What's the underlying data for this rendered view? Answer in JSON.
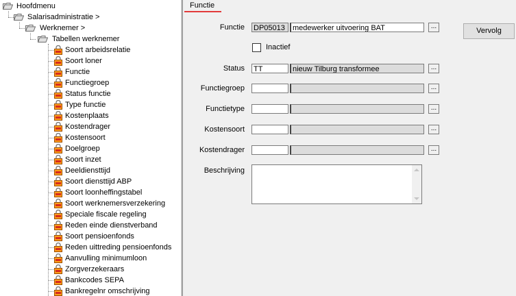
{
  "tree": {
    "root": "Hoofdmenu",
    "level1": "Salarisadministratie >",
    "level2": "Werknemer >",
    "level3": "Tabellen werknemer",
    "items": [
      "Soort arbeidsrelatie",
      "Soort loner",
      "Functie",
      "Functiegroep",
      "Status functie",
      "Type functie",
      "Kostenplaats",
      "Kostendrager",
      "Kostensoort",
      "Doelgroep",
      "Soort inzet",
      "Deeldiensttijd",
      "Soort diensttijd ABP",
      "Soort loonheffingstabel",
      "Soort werknemersverzekering",
      "Speciale fiscale regeling",
      "Reden einde dienstverband",
      "Soort pensioenfonds",
      "Reden uittreding pensioenfonds",
      "Aanvulling minimumloon",
      "Zorgverzekeraars",
      "Bankcodes SEPA",
      "Bankregelnr omschrijving"
    ]
  },
  "form": {
    "tab": "Functie",
    "vervolg": "Vervolg",
    "lookup": "...",
    "inactief": "Inactief",
    "beschrijving_label": "Beschrijving",
    "fields": [
      {
        "label": "Functie",
        "code": "DP05013",
        "desc": "medewerker uitvoering BAT"
      },
      {
        "label": "Status",
        "code": "TT",
        "desc": "nieuw Tilburg transformee"
      },
      {
        "label": "Functiegroep",
        "code": "",
        "desc": ""
      },
      {
        "label": "Functietype",
        "code": "",
        "desc": ""
      },
      {
        "label": "Kostensoort",
        "code": "",
        "desc": ""
      },
      {
        "label": "Kostendrager",
        "code": "",
        "desc": ""
      }
    ]
  },
  "icons": {
    "folder": "folder-open-icon",
    "item": "table-item-icon"
  },
  "colors": {
    "tab_underline": "#e23a3a",
    "readonly_field": "#dcdcdc"
  }
}
